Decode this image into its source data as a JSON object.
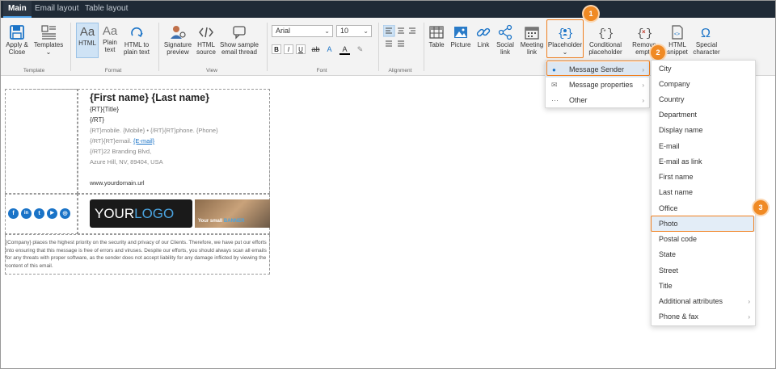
{
  "tabs": [
    {
      "label": "Main"
    },
    {
      "label": "Email layout"
    },
    {
      "label": "Table layout"
    }
  ],
  "ribbon": {
    "apply_close": "Apply &",
    "apply_close2": "Close",
    "templates": "Templates",
    "templates_chev": "⌄",
    "group_template": "Template",
    "html": "HTML",
    "plain_text": "Plain",
    "plain_text2": "text",
    "html_to_plain": "HTML to",
    "html_to_plain2": "plain text",
    "group_format": "Format",
    "signature_preview": "Signature",
    "signature_preview2": "preview",
    "html_source": "HTML",
    "html_source2": "source",
    "show_sample": "Show sample",
    "show_sample2": "email thread",
    "group_view": "View",
    "font_name": "Arial",
    "font_size": "10",
    "group_font": "Font",
    "group_alignment": "Alignment",
    "table": "Table",
    "picture": "Picture",
    "link": "Link",
    "social_link": "Social",
    "social_link2": "link",
    "meeting_link": "Meeting",
    "meeting_link2": "link",
    "placeholder": "Placeholder",
    "placeholder_chev": "⌄",
    "conditional": "Conditional",
    "conditional2": "placeholder ⌄",
    "remove_empty": "Remove",
    "remove_empty2": "empty",
    "html_snippet": "HTML",
    "html_snippet2": "snippet",
    "special_char": "Special",
    "special_char2": "character"
  },
  "badges": [
    "1",
    "2",
    "3"
  ],
  "signature": {
    "name": "{First name} {Last name}",
    "title": "{RT}{Title}",
    "rt_close": "{/RT}",
    "phones": "{RT}mobile. {Mobile} • {/RT}{RT}phone. {Phone}",
    "email_prefix": "{/RT}{RT}email. ",
    "email_link": "{E-mail}",
    "address1": "{/RT}22 Branding Blvd,",
    "address2": "Azure Hill, NV, 89404, USA",
    "domain": "www.yourdomain.url",
    "logo_your": "YOUR",
    "logo_logo": "LOGO",
    "banner_small": "Your small ",
    "banner_word": "BANNER",
    "disclaimer": "{Company} places the highest priority on the security and privacy of our Clients. Therefore, we have put our efforts into ensuring that this message is free of errors and viruses. Despite our efforts, you should always scan all emails for any threats with proper software, as the sender does not accept liability for any damage inflicted by viewing the content of this email."
  },
  "social_icons": [
    "f",
    "in",
    "t",
    "▶",
    "◎"
  ],
  "menu1": [
    {
      "label": "Message Sender",
      "icon": "person-icon"
    },
    {
      "label": "Message properties",
      "icon": "envelope-icon"
    },
    {
      "label": "Other",
      "icon": "dots-icon"
    }
  ],
  "menu2": [
    "City",
    "Company",
    "Country",
    "Department",
    "Display name",
    "E-mail",
    "E-mail as link",
    "First name",
    "Last name",
    "Office",
    "Photo",
    "Postal code",
    "State",
    "Street",
    "Title",
    "Additional attributes",
    "Phone & fax"
  ],
  "colors": {
    "accent": "#f08a24",
    "brand": "#1a73c7",
    "tabbar": "#1f2a36"
  }
}
